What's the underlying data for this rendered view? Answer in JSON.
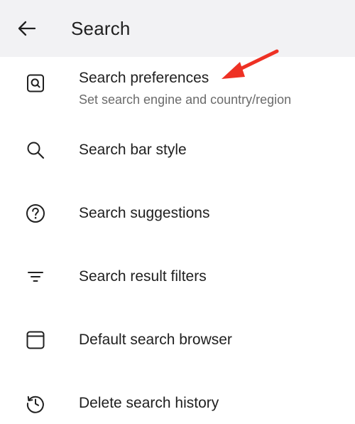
{
  "header": {
    "title": "Search",
    "back_icon": "arrow-left-icon",
    "background": "#f2f2f4"
  },
  "items": [
    {
      "label": "Search preferences",
      "sublabel": "Set search engine and country/region",
      "icon": "search-box-icon"
    },
    {
      "label": "Search bar style",
      "icon": "magnifier-icon"
    },
    {
      "label": "Search suggestions",
      "icon": "question-circle-icon"
    },
    {
      "label": "Search result filters",
      "icon": "filter-lines-icon"
    },
    {
      "label": "Default search browser",
      "icon": "browser-window-icon"
    },
    {
      "label": "Delete search history",
      "icon": "history-icon"
    }
  ],
  "annotation": {
    "type": "arrow",
    "color": "#ee3124",
    "points_to": "Search preferences"
  }
}
